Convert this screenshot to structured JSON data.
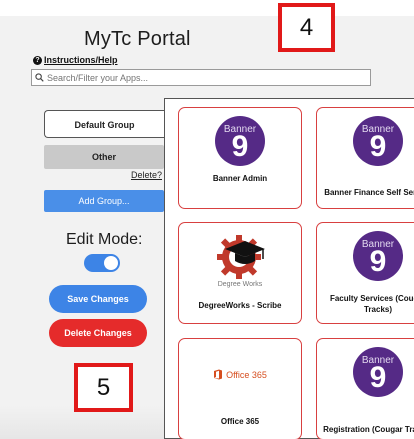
{
  "portal": {
    "title": "MyTc Portal",
    "help_link": "Instructions/Help",
    "search_placeholder": "Search/Filter your Apps..."
  },
  "groups": {
    "tabs": [
      "Default Group",
      "Other"
    ],
    "delete_link": "Delete?",
    "add_group_button": "Add Group..."
  },
  "edit_mode": {
    "label": "Edit Mode:",
    "toggle_on": true,
    "save_button": "Save Changes",
    "delete_button": "Delete Changes"
  },
  "apps": [
    {
      "name": "Banner Admin",
      "logo": "banner-9",
      "logo_word": "Banner",
      "logo_num": "9"
    },
    {
      "name": "Banner Finance Self Service",
      "logo": "banner-9",
      "logo_word": "Banner",
      "logo_num": "9"
    },
    {
      "name": "DegreeWorks - Scribe",
      "logo": "degreeworks",
      "logo_sub": "Degree Works"
    },
    {
      "name": "Faculty Services (Cougar Tracks)",
      "logo": "banner-9",
      "logo_word": "Banner",
      "logo_num": "9"
    },
    {
      "name": "Office 365",
      "logo": "office-365",
      "logo_text": "Office 365"
    },
    {
      "name": "Registration (Cougar Tracks)",
      "logo": "banner-9",
      "logo_word": "Banner",
      "logo_num": "9"
    }
  ],
  "annotations": [
    "4",
    "5"
  ],
  "colors": {
    "banner_purple": "#552a86",
    "tile_border": "#d84040",
    "primary_blue": "#3d84e6",
    "danger_red": "#e52b2b",
    "annotation_red": "#e11919",
    "office_orange": "#d64e1f"
  }
}
